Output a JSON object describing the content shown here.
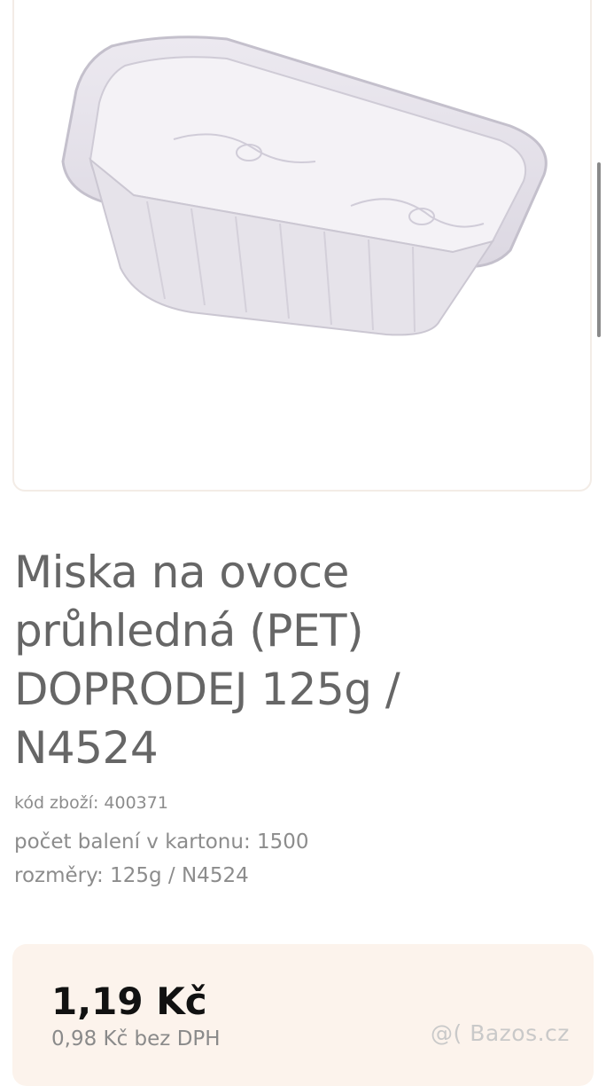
{
  "product": {
    "image_alt": "Miska na ovoce průhledná (PET)",
    "title": "Miska na ovoce průhledná (PET) DOPRODEJ 125g / N4524",
    "code_line": "kód zboží: 400371",
    "count_line": "počet balení v kartonu: 1500",
    "dims_line": "rozměry: 125g / N4524"
  },
  "price": {
    "value": "1,19 Kč",
    "without_vat": "0,98 Kč bez DPH"
  },
  "watermark": "@( Bazos.cz"
}
